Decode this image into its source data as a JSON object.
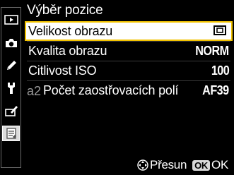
{
  "title": "Výběr pozice",
  "tabs": [
    {
      "icon": "playback-icon",
      "active": false
    },
    {
      "icon": "camera-icon",
      "active": false
    },
    {
      "icon": "pencil-icon",
      "active": false
    },
    {
      "icon": "wrench-icon",
      "active": false
    },
    {
      "icon": "retouch-icon",
      "active": false
    },
    {
      "icon": "my-menu-icon",
      "active": true
    }
  ],
  "items": [
    {
      "label": "Velikost obrazu",
      "value": "",
      "value_icon": "image-size-icon",
      "selected": true
    },
    {
      "label": "Kvalita obrazu",
      "value": "NORM",
      "selected": false
    },
    {
      "label": "Citlivost ISO",
      "value": "100",
      "selected": false
    },
    {
      "prefix": "a2",
      "label": "Počet zaostřovacích polí",
      "value": "AF39",
      "selected": false
    }
  ],
  "footer": {
    "move_label": "Přesun",
    "ok_badge": "OK",
    "ok_label": "OK"
  },
  "colors": {
    "background": "#000000",
    "selection_fill": "#ffffff",
    "selection_border": "#f2c200",
    "text": "#ffffff"
  }
}
